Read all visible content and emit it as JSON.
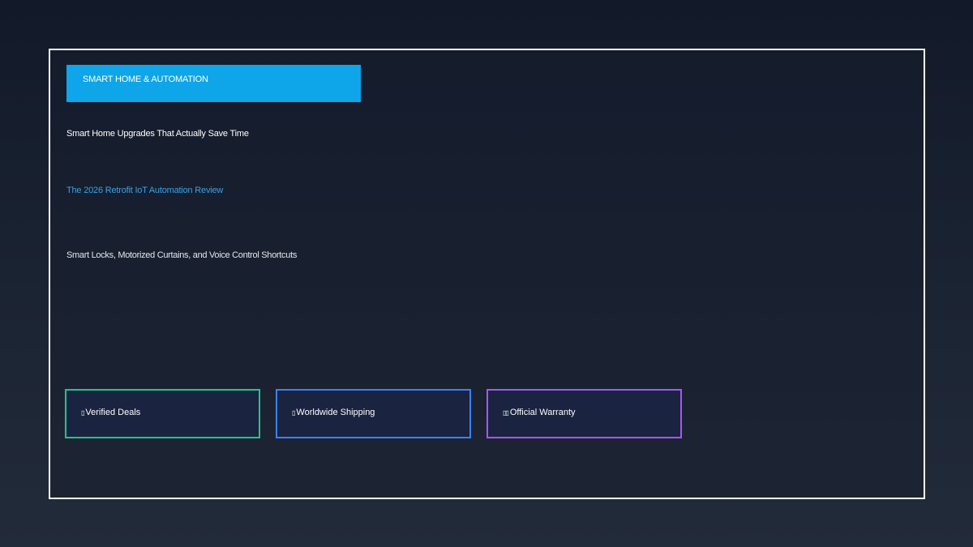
{
  "category": {
    "label": "SMART HOME & AUTOMATION",
    "accent_color": "#0ea5e9"
  },
  "headline": "Smart Home Upgrades That Actually Save Time",
  "review_title": "The 2026 Retrofit IoT Automation Review",
  "topics": "Smart Locks, Motorized Curtains, and Voice Control Shortcuts",
  "badges": [
    {
      "icon": "check-icon",
      "glyph": "▯",
      "label": "Verified Deals",
      "color": "#22c58b"
    },
    {
      "icon": "globe-icon",
      "glyph": "▯",
      "label": "Worldwide Shipping",
      "color": "#3b82f6"
    },
    {
      "icon": "shield-icon",
      "glyph": "▯▯",
      "label": "Official Warranty",
      "color": "#a855f7"
    }
  ]
}
